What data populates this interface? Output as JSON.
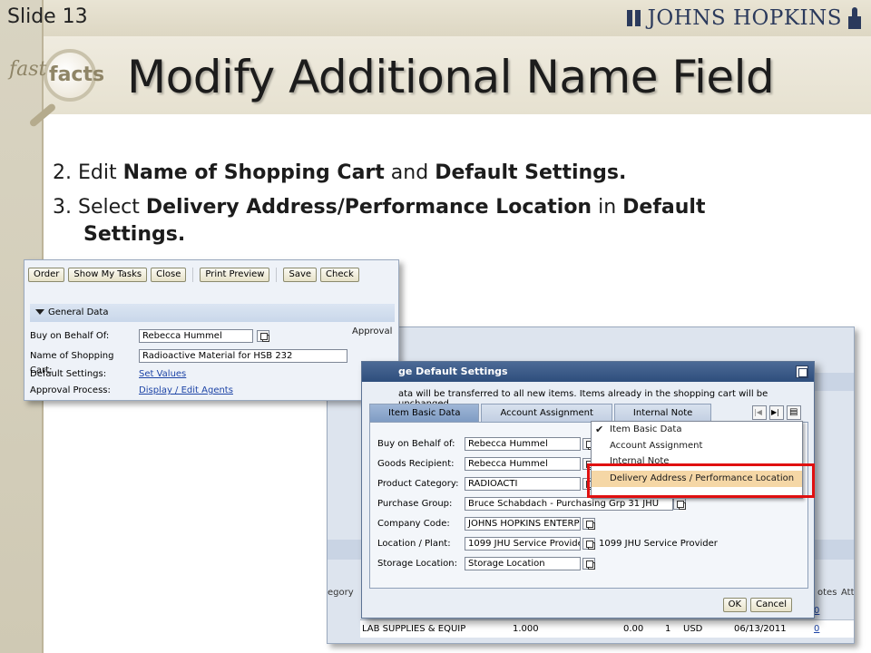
{
  "slide": {
    "number_label": "Slide 13",
    "brand": "JOHNS HOPKINS",
    "logo_fast": "fast",
    "logo_facts": "facts",
    "title": "Modify Additional Name Field"
  },
  "steps": {
    "s2_prefix": "2. Edit ",
    "s2_bold1": "Name of Shopping Cart",
    "s2_mid": " and ",
    "s2_bold2": "Default Settings.",
    "s3_prefix": "3. Select ",
    "s3_bold1": "Delivery Address/Performance Location",
    "s3_mid": " in ",
    "s3_bold2a": "Default",
    "s3_bold2b": "Settings."
  },
  "sap_main": {
    "toolbar": [
      "Order",
      "Show My Tasks",
      "Close",
      "Print Preview",
      "Save",
      "Check"
    ],
    "section_title": "General Data",
    "buy_on_behalf_label": "Buy on Behalf Of:",
    "buy_on_behalf_value": "Rebecca Hummel",
    "cart_name_label": "Name of Shopping Cart:",
    "cart_name_value": "Radioactive Material for HSB 232",
    "default_settings_label": "Default Settings:",
    "default_settings_link": "Set Values",
    "approval_process_label": "Approval Process:",
    "approval_process_link": "Display / Edit Agents",
    "approval_side_label": "Approval"
  },
  "sap_background": {
    "col_category": "egory",
    "col_notes": "otes",
    "col_att": "Att",
    "row": {
      "category": "LAB SUPPLIES & EQUIP",
      "qty": "1.000",
      "price": "0.00",
      "per": "1",
      "currency": "USD",
      "date": "06/13/2011",
      "count": "0"
    },
    "row_above_count": "0"
  },
  "dialog": {
    "title": "ge Default Settings",
    "info": "ata will be transferred to all new items. Items already in the shopping cart will be unchanged.",
    "tabs": [
      "Item Basic Data",
      "Account Assignment",
      "Internal Note"
    ],
    "fields": {
      "buy_on_behalf_label": "Buy on Behalf of:",
      "buy_on_behalf_value": "Rebecca Hummel",
      "goods_recipient_label": "Goods Recipient:",
      "goods_recipient_value": "Rebecca Hummel",
      "product_category_label": "Product Category:",
      "product_category_value": "RADIOACTI",
      "purchase_group_label": "Purchase Group:",
      "purchase_group_value": "Bruce Schabdach - Purchasing Grp 31 JHU",
      "company_code_label": "Company Code:",
      "company_code_value": "JOHNS HOPKINS ENTERPI",
      "location_label": "Location / Plant:",
      "location_value": "1099 JHU Service Provide",
      "location_desc": "1099 JHU Service Provider",
      "storage_label": "Storage Location:",
      "storage_value": "Storage Location"
    },
    "ok_label": "OK",
    "cancel_label": "Cancel"
  },
  "dropdown": {
    "items": [
      "Item Basic Data",
      "Account Assignment",
      "Internal Note",
      "Delivery Address / Performance Location"
    ],
    "checked_index": 0,
    "selected_index": 3
  },
  "colors": {
    "highlight_box": "#e01010",
    "selected_item": "#f5d7a6",
    "dialog_title": "#2e4e7c"
  }
}
